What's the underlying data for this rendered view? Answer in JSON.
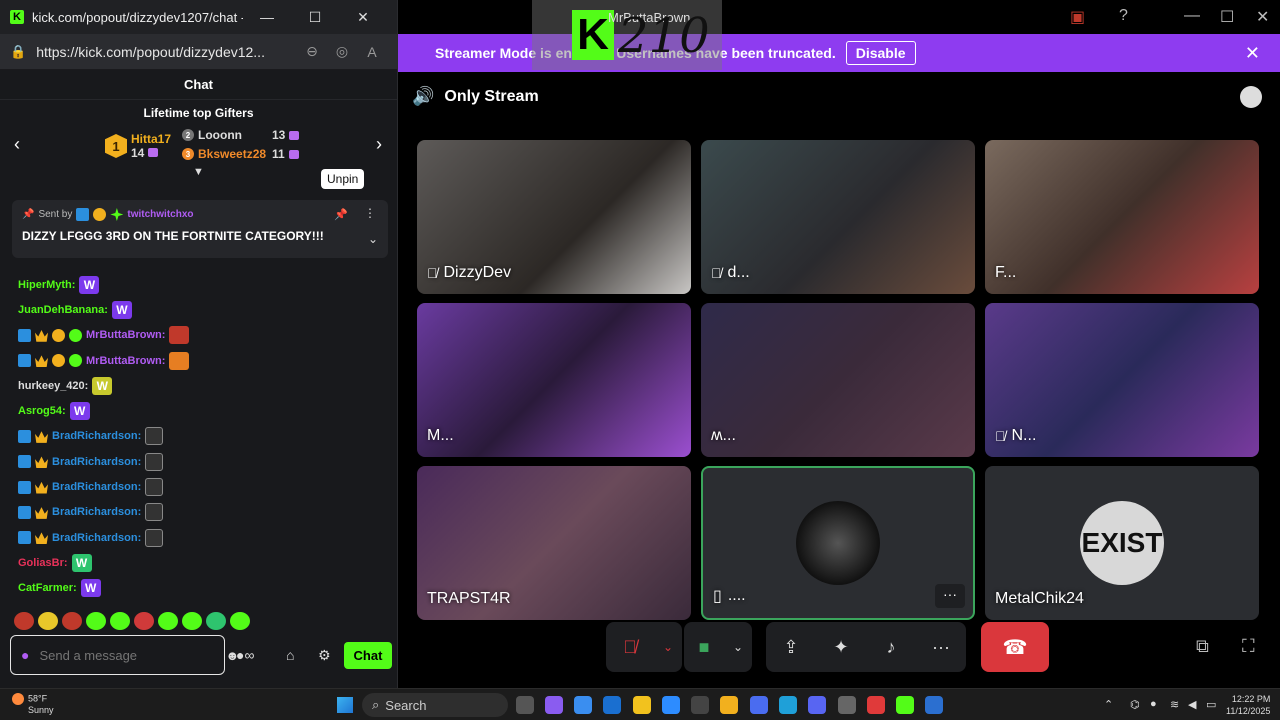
{
  "popout": {
    "title": "kick.com/popout/dizzydev1207/chat -...",
    "url": "https://kick.com/popout/dizzydev12...",
    "chat_header": "Chat",
    "gifters_title": "Lifetime top Gifters",
    "gifters": [
      {
        "rank": "1",
        "name": "Hitta17",
        "count": "14",
        "color": "#f2b01e"
      },
      {
        "rank": "2",
        "name": "Looonn",
        "count": "13",
        "color": "#dddddd"
      },
      {
        "rank": "3",
        "name": "Bksweetz28",
        "count": "11",
        "color": "#f08a2a"
      }
    ],
    "tooltip": "Unpin",
    "pinned": {
      "sent_by": "Sent by",
      "sender": "twitchwitchxo",
      "message": "DIZZY LFGGG 3RD ON THE FORTNITE CATEGORY!!!"
    },
    "messages": [
      {
        "name": "HiperMyth:",
        "color": "#53fc18",
        "badges": [],
        "emote": "W"
      },
      {
        "name": "JuanDehBanana:",
        "color": "#53fc18",
        "badges": [],
        "emote": "W"
      },
      {
        "name": "MrButtaBrown:",
        "color": "#b05cf3",
        "badges": [
          "blue",
          "crown",
          "gold",
          "green"
        ],
        "emote": "red"
      },
      {
        "name": "MrButtaBrown:",
        "color": "#b05cf3",
        "badges": [
          "blue",
          "crown",
          "gold",
          "green"
        ],
        "emote": "efg"
      },
      {
        "name": "hurkeey_420:",
        "color": "#dddddd",
        "badges": [],
        "emote": "W-y"
      },
      {
        "name": "Asrog54:",
        "color": "#53fc18",
        "badges": [],
        "emote": "W"
      },
      {
        "name": "BradRichardson:",
        "color": "#2b8fde",
        "badges": [
          "blue",
          "crown"
        ],
        "emote": "mask"
      },
      {
        "name": "BradRichardson:",
        "color": "#2b8fde",
        "badges": [
          "blue",
          "crown"
        ],
        "emote": "mask"
      },
      {
        "name": "BradRichardson:",
        "color": "#2b8fde",
        "badges": [
          "blue",
          "crown"
        ],
        "emote": "mask"
      },
      {
        "name": "BradRichardson:",
        "color": "#2b8fde",
        "badges": [
          "blue",
          "crown"
        ],
        "emote": "mask"
      },
      {
        "name": "BradRichardson:",
        "color": "#2b8fde",
        "badges": [
          "blue",
          "crown"
        ],
        "emote": "mask"
      },
      {
        "name": "GoliasBr:",
        "color": "#e8325a",
        "badges": [],
        "emote": "W-g"
      },
      {
        "name": "CatFarmer:",
        "color": "#53fc18",
        "badges": [],
        "emote": "W"
      }
    ],
    "composer_placeholder": "Send a message",
    "chat_button": "Chat"
  },
  "discord": {
    "overlay_text": "210",
    "overlay_name": "MrButtaBrown",
    "banner_text": "Streamer Mode is enabled. Usernames have been truncated.",
    "banner_button": "Disable",
    "channel_name": "Only Stream",
    "tiles": [
      {
        "label": "DizzyDev",
        "muted": true
      },
      {
        "label": "d...",
        "muted": true
      },
      {
        "label": "F...",
        "muted": false
      },
      {
        "label": "M...",
        "muted": false
      },
      {
        "label": "ʍ...",
        "muted": false
      },
      {
        "label": "N...",
        "muted": true
      },
      {
        "label": "TRAPST4R",
        "muted": false
      },
      {
        "label": "....",
        "muted": false
      },
      {
        "label": "MetalChik24",
        "muted": false
      }
    ],
    "avatar_text": "EXIST"
  },
  "taskbar": {
    "temperature": "58°F",
    "condition": "Sunny",
    "search": "Search",
    "time": "12:22 PM",
    "date": "11/12/2025"
  }
}
